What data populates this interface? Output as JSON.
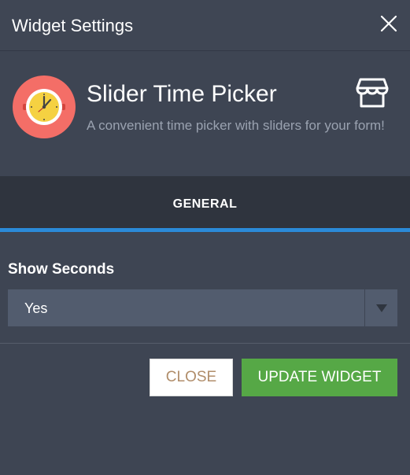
{
  "window": {
    "title": "Widget Settings",
    "close_icon": "close-icon"
  },
  "widget": {
    "name": "Slider Time Picker",
    "description": "A convenient time picker with sliders for your form!",
    "icon": "clock-icon",
    "store_icon": "store-icon"
  },
  "tabs": [
    {
      "label": "GENERAL",
      "active": true
    }
  ],
  "settings": {
    "show_seconds": {
      "label": "Show Seconds",
      "value": "Yes"
    }
  },
  "buttons": {
    "close_label": "CLOSE",
    "update_label": "UPDATE WIDGET"
  },
  "colors": {
    "background": "#3e4553",
    "tab_bar": "#2f343e",
    "tab_indicator": "#2b8ad8",
    "update_button": "#56a846",
    "close_text": "#b08d6a",
    "icon_circle": "#f46e67",
    "clock_face": "#f5d142"
  }
}
